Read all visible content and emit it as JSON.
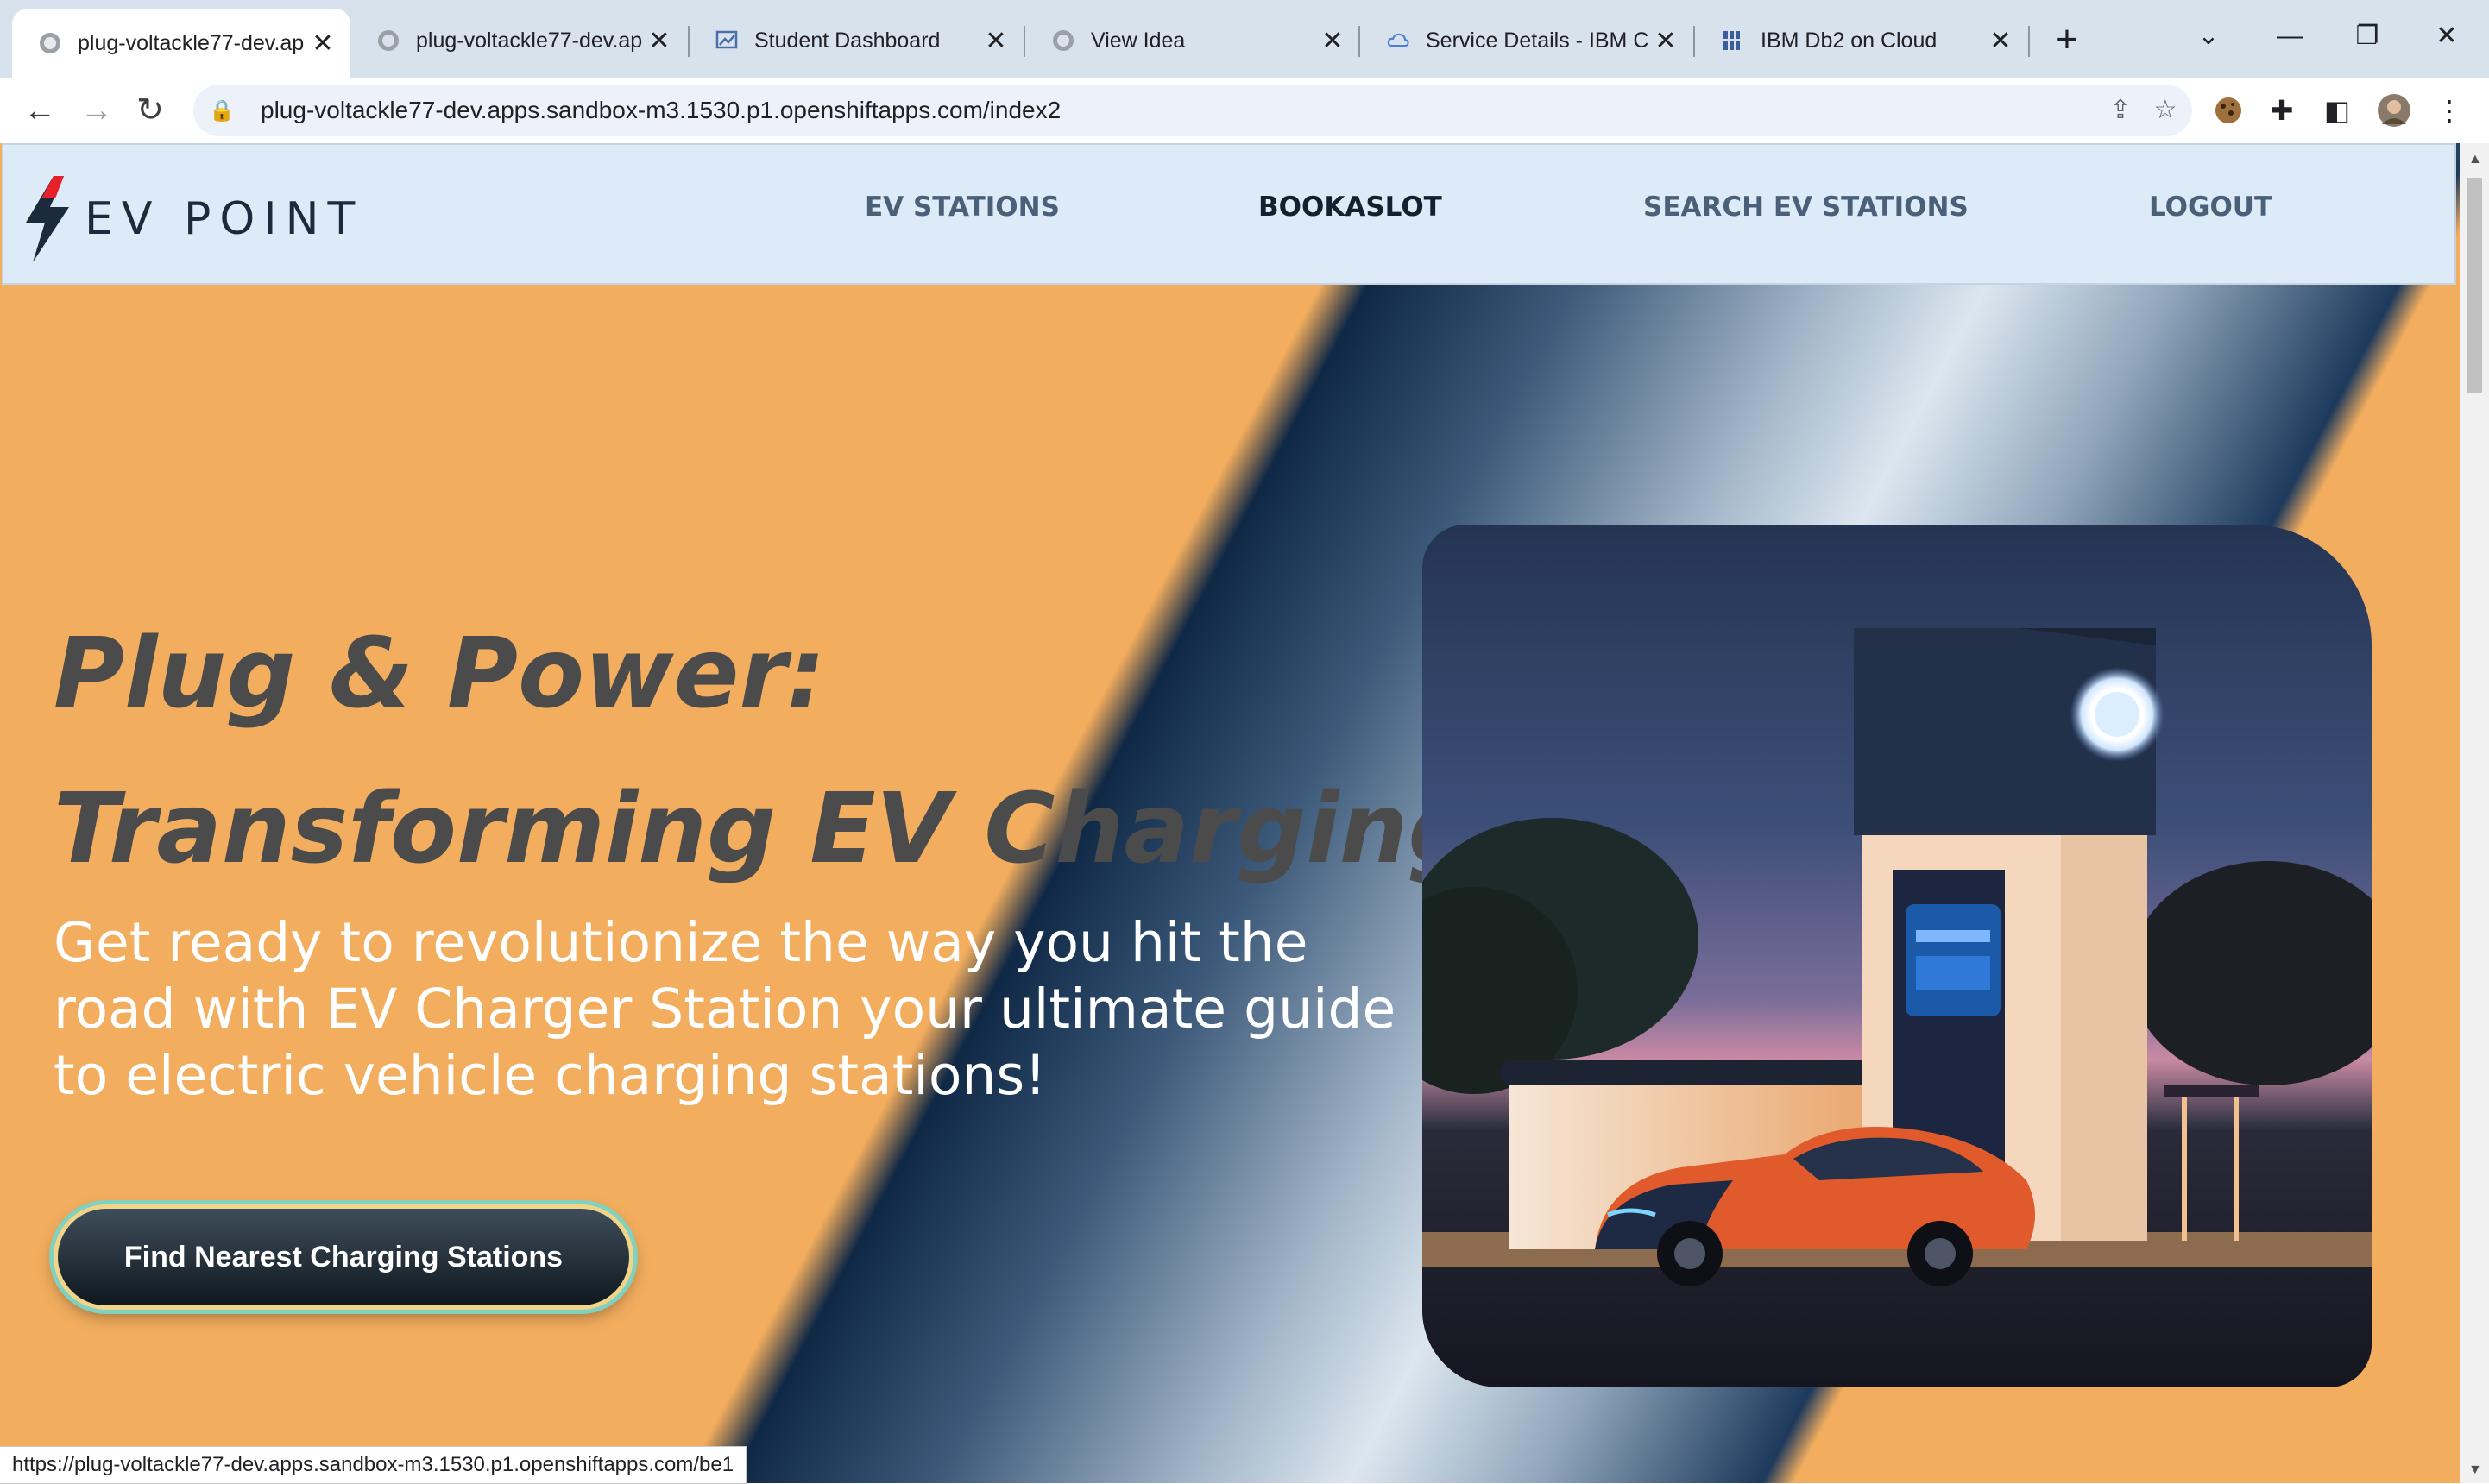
{
  "browser": {
    "tabs": [
      {
        "title": "plug-voltackle77-dev.ap",
        "active": true
      },
      {
        "title": "plug-voltackle77-dev.ap",
        "active": false
      },
      {
        "title": "Student Dashboard",
        "active": false
      },
      {
        "title": "View Idea",
        "active": false
      },
      {
        "title": "Service Details - IBM Clo",
        "active": false
      },
      {
        "title": "IBM Db2 on Cloud",
        "active": false
      }
    ],
    "new_tab": "+",
    "url": "plug-voltackle77-dev.apps.sandbox-m3.1530.p1.openshiftapps.com/index2",
    "status_url": "https://plug-voltackle77-dev.apps.sandbox-m3.1530.p1.openshiftapps.com/be1"
  },
  "site": {
    "logo_text": "EV POINT",
    "nav": [
      {
        "label": "EV STATIONS"
      },
      {
        "label": "BOOKASLOT",
        "current": true
      },
      {
        "label": "SEARCH EV STATIONS"
      },
      {
        "label": "LOGOUT"
      }
    ],
    "hero": {
      "headline_line1": "Plug & Power:",
      "headline_line2": "Transforming EV Charging",
      "subtext": "Get ready to revolutionize the way you hit the road with EV Charger Station your ultimate guide to electric vehicle charging stations!",
      "cta_label": "Find Nearest Charging Stations"
    }
  },
  "colors": {
    "hero_orange": "#f2ad5e",
    "nav_bg": "#ddeaf8",
    "headline": "#4b4b4b",
    "cta_bg": "#1a242e"
  }
}
